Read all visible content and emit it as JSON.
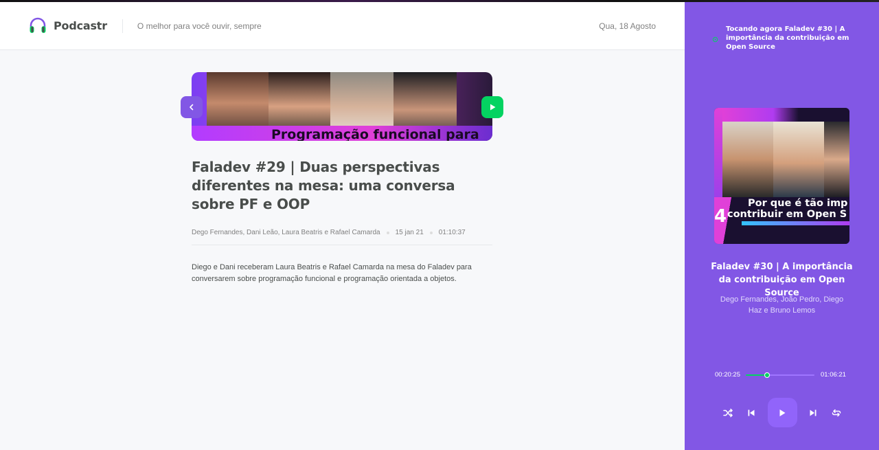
{
  "header": {
    "app_name": "Podcastr",
    "tagline": "O melhor para você ouvir, sempre",
    "date": "Qua, 18 Agosto"
  },
  "episode": {
    "thumbnail_text": "Programação funcional para",
    "title": "Faladev #29 | Duas perspectivas diferentes na mesa: uma conversa sobre PF e OOP",
    "members": "Dego Fernandes, Dani Leão, Laura Beatris e Rafael Camarda",
    "published_at": "15 jan 21",
    "duration": "01:10:37",
    "description": "Diego e Dani receberam Laura Beatris e Rafael Camarda na mesa do Faladev para conversarem sobre programação funcional e programação orientada a objetos.",
    "icons": {
      "prev": "chevron-left-icon",
      "play": "play-icon"
    }
  },
  "player": {
    "now_playing": "Tocando agora Faladev #30 | A importância da contribuição em Open Source",
    "cover_text_line1": "Por que é tão imp",
    "cover_text_line2": "contribuir em Open S",
    "cover_number": "4",
    "title": "Faladev #30 | A importância da contribuição em Open Source",
    "members": "Dego Fernandes, João Pedro, Diego Haz e Bruno Lemos",
    "current_time": "00:20:25",
    "total_time": "01:06:21",
    "progress_fraction": 0.31,
    "icons": {
      "now_playing": "playing-icon",
      "shuffle": "shuffle-icon",
      "previous": "skip-previous-icon",
      "play": "play-icon",
      "next": "skip-next-icon",
      "repeat": "repeat-icon"
    }
  },
  "colors": {
    "purple": "#8257E5",
    "green": "#04D361",
    "text": "#494D4B",
    "muted": "#808080"
  }
}
